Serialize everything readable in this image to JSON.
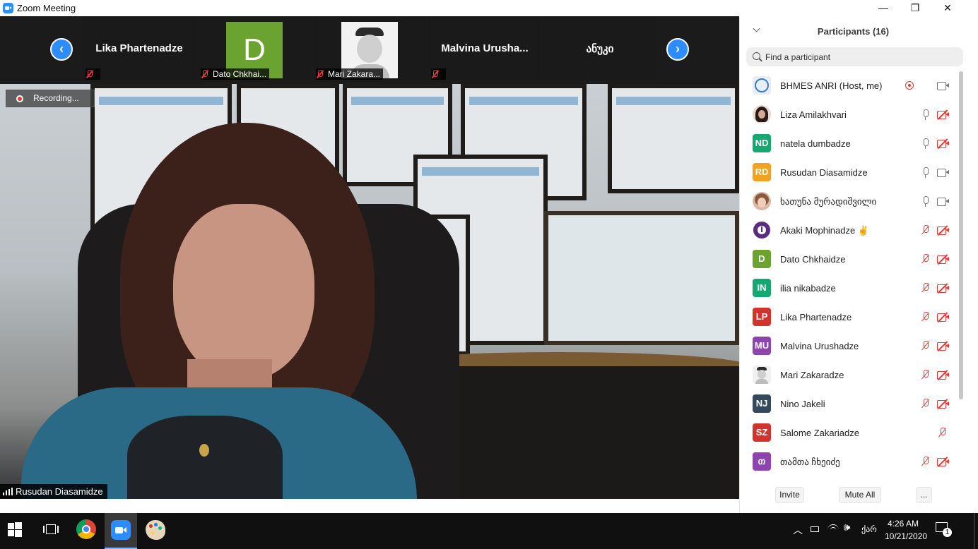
{
  "window": {
    "title": "Zoom Meeting",
    "minimize_glyph": "—",
    "restore_glyph": "❐",
    "close_glyph": "✕"
  },
  "thumbnail_strip": {
    "prev_glyph": "‹",
    "next_glyph": "›",
    "tiles": [
      {
        "name": "Lika Phartenadze",
        "display": "name",
        "muted": true,
        "tag": ""
      },
      {
        "name": "Dato Chkhai...",
        "display": "avatar-letter",
        "letter": "D",
        "color": "#6BA331",
        "muted": true,
        "tag": "Dato Chkhai..."
      },
      {
        "name": "Mari Zakara...",
        "display": "avatar-image",
        "muted": true,
        "tag": "Mari Zakara..."
      },
      {
        "name": "Malvina  Urusha...",
        "display": "name",
        "muted": true,
        "tag": ""
      },
      {
        "name": "ანუკი",
        "display": "name",
        "muted": false,
        "tag": ""
      }
    ]
  },
  "main_video": {
    "recording_label": "Recording...",
    "speaker_name": "Rusudan Diasamidze"
  },
  "participants": {
    "title": "Participants (16)",
    "search_placeholder": "Find a participant",
    "list": [
      {
        "name": "BHMES ANRI (Host, me)",
        "initials": "",
        "avatar_color": "#e8eef5",
        "avatar": "image",
        "recording": true,
        "mic": "on-none",
        "cam": "on"
      },
      {
        "name": "Liza Amilakhvari",
        "initials": "",
        "avatar_color": "#e9d9d4",
        "avatar": "photo",
        "mic": "on",
        "cam": "off"
      },
      {
        "name": "natela dumbadze",
        "initials": "ND",
        "avatar_color": "#15A871",
        "mic": "on",
        "cam": "off"
      },
      {
        "name": "Rusudan Diasamidze",
        "initials": "RD",
        "avatar_color": "#F2A120",
        "mic": "on",
        "cam": "on"
      },
      {
        "name": "ხათუნა მურადიშვილი",
        "initials": "",
        "avatar_color": "#d9b9a6",
        "avatar": "photo",
        "mic": "on",
        "cam": "on"
      },
      {
        "name": "Akaki Mophinadze ✌",
        "initials": "",
        "avatar_color": "#5a2d82",
        "avatar": "icon",
        "mic": "muted",
        "cam": "off"
      },
      {
        "name": "Dato Chkhaidze",
        "initials": "D",
        "avatar_color": "#6BA331",
        "mic": "muted",
        "cam": "off"
      },
      {
        "name": "ilia nikabadze",
        "initials": "IN",
        "avatar_color": "#15A871",
        "mic": "muted",
        "cam": "off"
      },
      {
        "name": "Lika Phartenadze",
        "initials": "LP",
        "avatar_color": "#D1342F",
        "mic": "muted",
        "cam": "off"
      },
      {
        "name": "Malvina Urushadze",
        "initials": "MU",
        "avatar_color": "#8E44AD",
        "mic": "muted",
        "cam": "off"
      },
      {
        "name": "Mari Zakaradze",
        "initials": "",
        "avatar_color": "#f0f0f0",
        "avatar": "image",
        "mic": "muted",
        "cam": "off"
      },
      {
        "name": "Nino Jakeli",
        "initials": "NJ",
        "avatar_color": "#34495E",
        "mic": "muted",
        "cam": "off"
      },
      {
        "name": "Salome Zakariadze",
        "initials": "SZ",
        "avatar_color": "#D1342F",
        "mic": "none",
        "cam": "muted-only"
      },
      {
        "name": "თამთა ჩხეიძე",
        "initials": "თ",
        "avatar_color": "#8E44AD",
        "mic": "muted",
        "cam": "off"
      }
    ],
    "buttons": {
      "invite": "Invite",
      "mute_all": "Mute All",
      "more": "..."
    }
  },
  "taskbar": {
    "time": "4:26 AM",
    "date": "10/21/2020",
    "language": "ქარ",
    "notification_count": "1"
  }
}
